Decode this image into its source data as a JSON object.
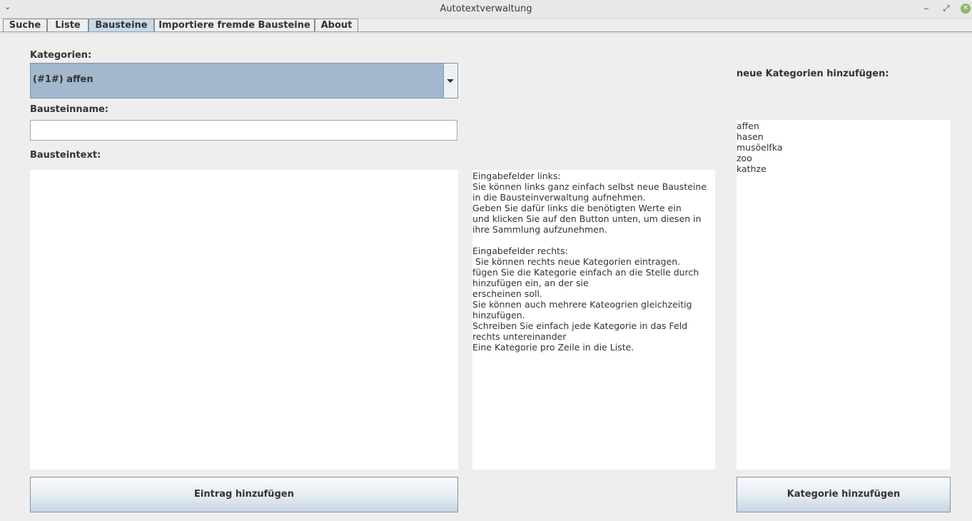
{
  "window": {
    "title": "Autotextverwaltung",
    "menu_glyph": "⌄",
    "minimize_glyph": "‒",
    "maximize_glyph": "⤢",
    "close_glyph": "✕"
  },
  "tabs": [
    {
      "label": "Suche"
    },
    {
      "label": "Liste"
    },
    {
      "label": "Bausteine"
    },
    {
      "label": "Importiere fremde Bausteine"
    },
    {
      "label": "About"
    }
  ],
  "active_tab": "Bausteine",
  "form": {
    "categories_label": "Kategorien:",
    "category_selected": "(#1#) affen",
    "name_label": "Bausteinname:",
    "name_value": "",
    "text_label": "Bausteintext:",
    "text_value": "",
    "add_entry_button": "Eintrag hinzufügen"
  },
  "help_text": "Eingabefelder links:\nSie können links ganz einfach selbst neue Bausteine\nin die Bausteinverwaltung aufnehmen.\nGeben Sie dafür links die benötigten Werte ein\nund klicken Sie auf den Button unten, um diesen in\nihre Sammlung aufzunehmen.\n\nEingabefelder rechts:\n Sie können rechts neue Kategorien eintragen.\nfügen Sie die Kategorie einfach an die Stelle durch\nhinzufügen ein, an der sie\nerscheinen soll.\nSie können auch mehrere Kateogrien gleichzeitig\nhinzufügen.\nSchreiben Sie einfach jede Kategorie in das Feld\nrechts untereinander\nEine Kategorie pro Zeile in die Liste.",
  "new_categories": {
    "label": "neue Kategorien hinzufügen:",
    "lines": [
      "affen",
      "hasen",
      "musöelfka",
      "zoo",
      "kathze"
    ],
    "add_button": "Kategorie hinzufügen"
  },
  "colors": {
    "combo_selected_bg": "#a3b8cc",
    "active_tab_bg": "#c8dae9",
    "close_button": "#8cb763"
  }
}
